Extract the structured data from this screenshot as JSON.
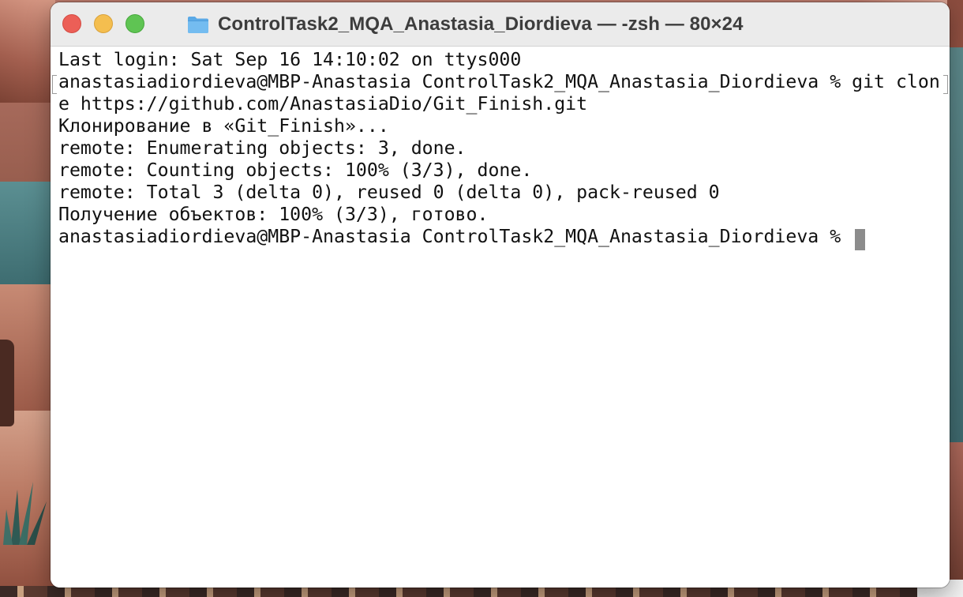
{
  "window": {
    "title": "ControlTask2_MQA_Anastasia_Diordieva — -zsh — 80×24",
    "title_icon": "folder-icon",
    "controls": {
      "close_color": "#ec5f57",
      "minimize_color": "#f4be4f",
      "maximize_color": "#5fc453"
    }
  },
  "terminal": {
    "lines": [
      "Last login: Sat Sep 16 14:10:02 on ttys000",
      "anastasiadiordieva@MBP-Anastasia ControlTask2_MQA_Anastasia_Diordieva % git clon",
      "e https://github.com/AnastasiaDio/Git_Finish.git",
      "Клонирование в «Git_Finish»...",
      "remote: Enumerating objects: 3, done.",
      "remote: Counting objects: 100% (3/3), done.",
      "remote: Total 3 (delta 0), reused 0 (delta 0), pack-reused 0",
      "Получение объектов: 100% (3/3), готово.",
      "anastasiadiordieva@MBP-Anastasia ControlTask2_MQA_Anastasia_Diordieva % "
    ],
    "cursor_color": "#8c8c8c",
    "background": "#ffffff",
    "foreground": "#111111"
  }
}
